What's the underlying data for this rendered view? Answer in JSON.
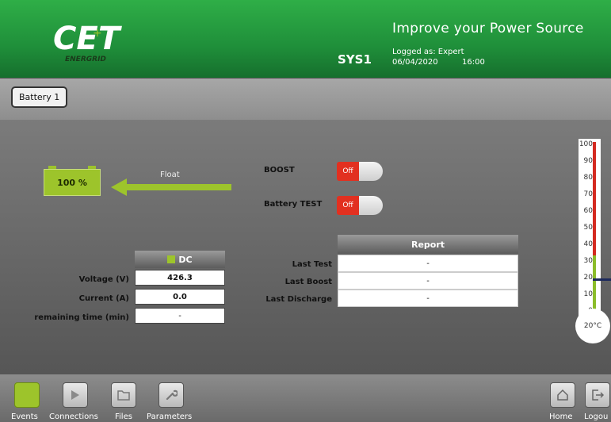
{
  "header": {
    "logo_text": "CE+T",
    "logo_sub": "ENERGRID",
    "system": "SYS1",
    "tagline": "Improve your Power Source",
    "logged_as": "Logged as: Expert",
    "date": "06/04/2020",
    "time": "16:00"
  },
  "tabs": [
    {
      "label": "Battery 1"
    }
  ],
  "battery": {
    "percent_text": "100 %",
    "mode": "Float",
    "charge_fraction": 1.0
  },
  "controls": {
    "boost": {
      "label": "BOOST",
      "state": "Off"
    },
    "battery_test": {
      "label": "Battery TEST",
      "state": "Off"
    }
  },
  "dc_table": {
    "header": "DC",
    "rows": [
      {
        "label": "Voltage (V)",
        "value": "426.3"
      },
      {
        "label": "Current (A)",
        "value": "0.0"
      },
      {
        "label": "remaining time (min)",
        "value": "-"
      }
    ]
  },
  "report": {
    "header": "Report",
    "rows": [
      {
        "label": "Last Test",
        "value": "-"
      },
      {
        "label": "Last Boost",
        "value": "-"
      },
      {
        "label": "Last Discharge",
        "value": "-"
      }
    ]
  },
  "thermometer": {
    "ticks": [
      "100",
      "90",
      "80",
      "70",
      "60",
      "50",
      "40",
      "30",
      "20",
      "10",
      "0"
    ],
    "reading": "20°C",
    "value_celsius": 20
  },
  "footer": {
    "events": "Events",
    "connections": "Connections",
    "files": "Files",
    "parameters": "Parameters",
    "home": "Home",
    "logout": "Logou"
  },
  "colors": {
    "header_green": "#1f8f3a",
    "battery_green": "#9dc42b",
    "toggle_off_red": "#e23020",
    "thermo_red": "#d42a20"
  }
}
